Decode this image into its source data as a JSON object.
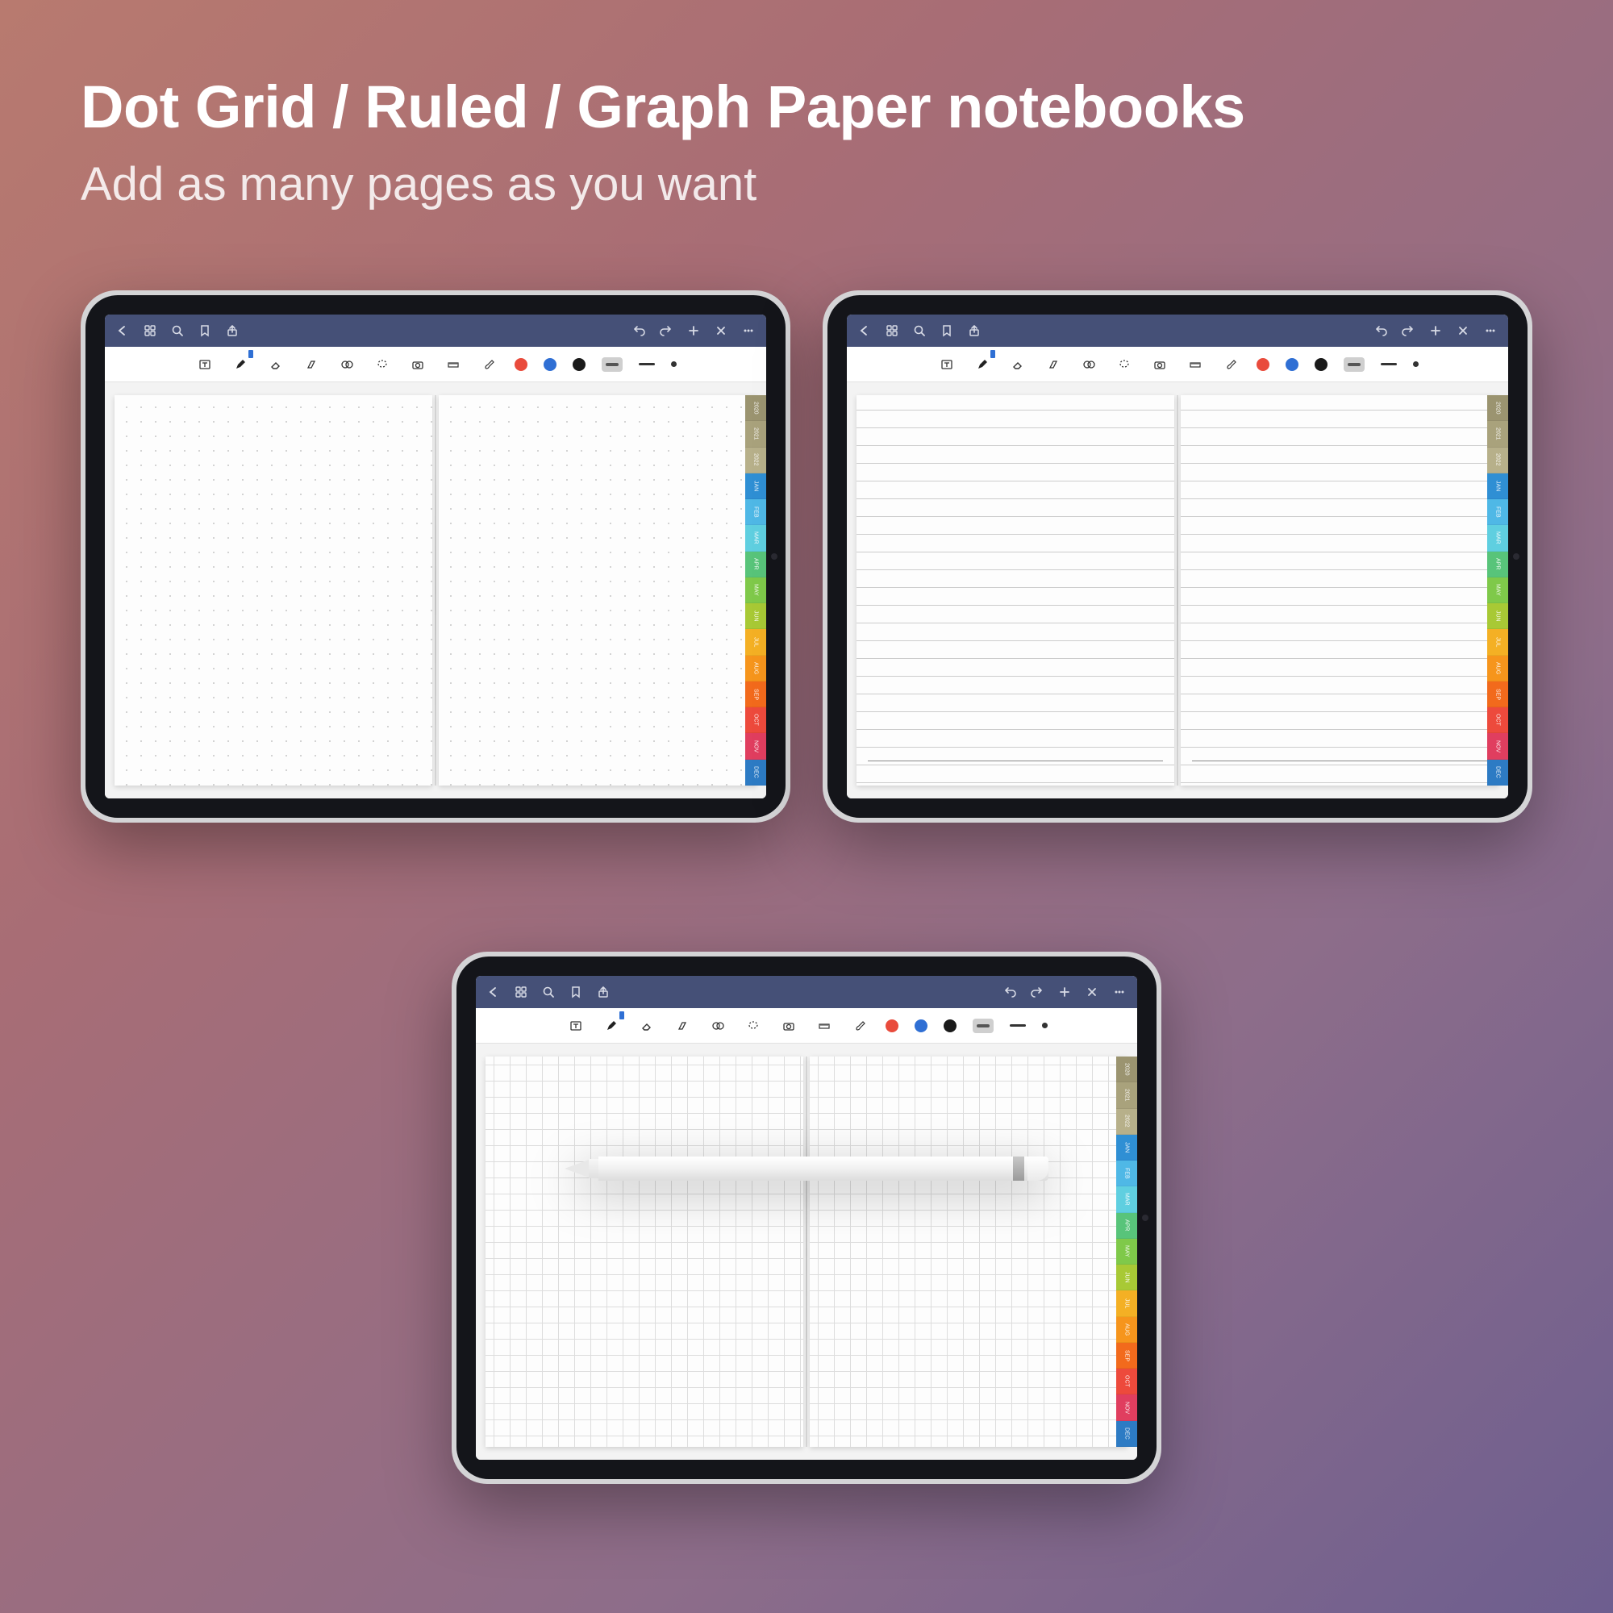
{
  "header": {
    "title": "Dot Grid / Ruled / Graph Paper notebooks",
    "subtitle": "Add as many pages as you want"
  },
  "tabs": [
    {
      "label": "2020",
      "color": "#9b9470"
    },
    {
      "label": "2021",
      "color": "#a9a27c"
    },
    {
      "label": "2022",
      "color": "#b7b08a"
    },
    {
      "label": "JAN",
      "color": "#2f8fd4"
    },
    {
      "label": "FEB",
      "color": "#4fb8e6"
    },
    {
      "label": "MAR",
      "color": "#5fcfe0"
    },
    {
      "label": "APR",
      "color": "#58c47a"
    },
    {
      "label": "MAY",
      "color": "#7fc94a"
    },
    {
      "label": "JUN",
      "color": "#a8c935"
    },
    {
      "label": "JUL",
      "color": "#f4b024"
    },
    {
      "label": "AUG",
      "color": "#f6951c"
    },
    {
      "label": "SEP",
      "color": "#f26a1c"
    },
    {
      "label": "OCT",
      "color": "#ed4a3c"
    },
    {
      "label": "NOV",
      "color": "#e03e5f"
    },
    {
      "label": "DEC",
      "color": "#2d7bc4"
    }
  ],
  "devices": [
    {
      "name": "dot-grid-notebook",
      "pageStyle": "dot"
    },
    {
      "name": "ruled-notebook",
      "pageStyle": "ruled"
    },
    {
      "name": "graph-notebook",
      "pageStyle": "graph"
    }
  ],
  "appbar": {
    "icons_left": [
      "back",
      "thumbnails",
      "search",
      "bookmark",
      "share"
    ],
    "icons_right": [
      "undo",
      "redo",
      "add",
      "close",
      "more"
    ]
  },
  "toolbar": {
    "icons": [
      "text-box",
      "pen",
      "eraser",
      "highlighter",
      "shapes",
      "lasso",
      "camera",
      "ruler",
      "brush"
    ],
    "colors": [
      "red",
      "blue",
      "black"
    ],
    "stroke": [
      "thick",
      "thin",
      "dot"
    ]
  }
}
